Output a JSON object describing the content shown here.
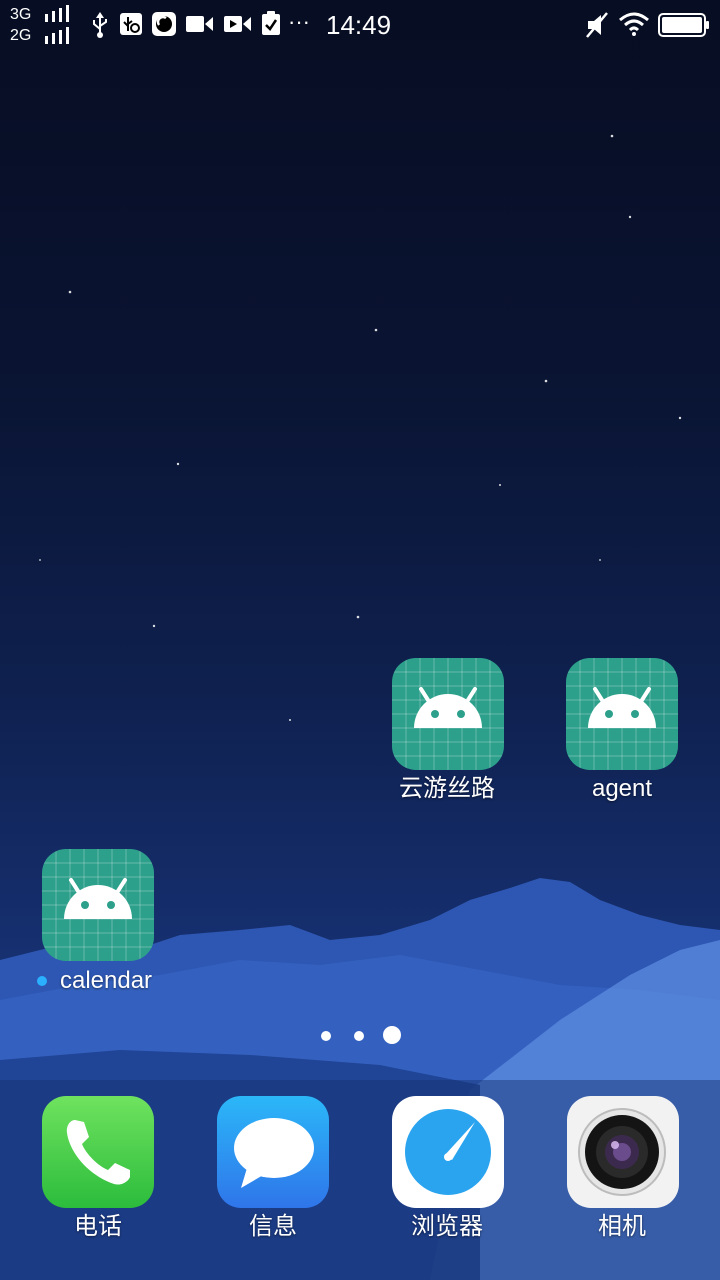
{
  "status_bar": {
    "network_1": "3G",
    "network_2": "2G",
    "time": "14:49",
    "more_label": "···",
    "icons": [
      "signal-bars-icon",
      "usb-icon",
      "usb-debug-icon",
      "camera-lens-icon",
      "video-icon",
      "video-play-icon",
      "clipboard-check-icon",
      "mute-icon",
      "wifi-icon",
      "battery-icon"
    ]
  },
  "home_apps": [
    {
      "label": "云游丝路",
      "icon": "android-icon"
    },
    {
      "label": "agent",
      "icon": "android-icon"
    },
    {
      "label": "calendar",
      "icon": "android-icon",
      "new_badge": true
    }
  ],
  "page_indicator": {
    "pages": 3,
    "current": 3
  },
  "dock": [
    {
      "label": "电话",
      "icon": "phone-icon"
    },
    {
      "label": "信息",
      "icon": "message-icon"
    },
    {
      "label": "浏览器",
      "icon": "browser-compass-icon"
    },
    {
      "label": "相机",
      "icon": "camera-icon"
    }
  ],
  "colors": {
    "android_tile": "#2da08b",
    "phone_green": "#3fcd45",
    "message_blue": "#2f8ff2",
    "browser_blue": "#2ba4f0",
    "badge_blue": "#2ab0ff"
  }
}
